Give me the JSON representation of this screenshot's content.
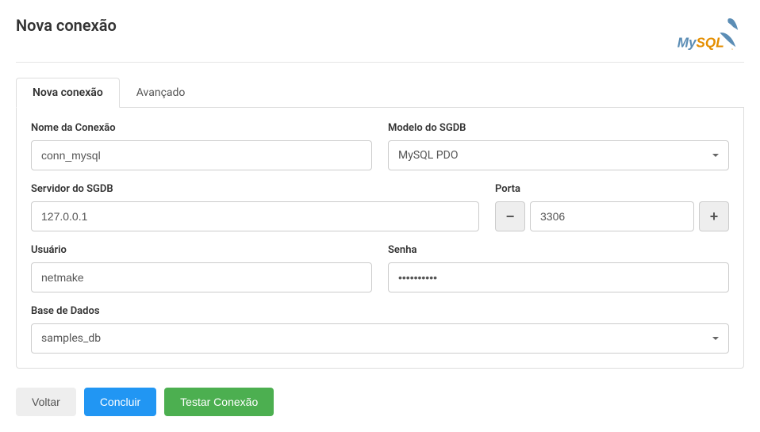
{
  "page_title": "Nova conexão",
  "logo_text": "MySQL",
  "tabs": {
    "new_connection": "Nova conexão",
    "advanced": "Avançado"
  },
  "form": {
    "connection_name": {
      "label": "Nome da Conexão",
      "value": "conn_mysql"
    },
    "sgdb_model": {
      "label": "Modelo do SGDB",
      "value": "MySQL PDO"
    },
    "sgdb_server": {
      "label": "Servidor do SGDB",
      "value": "127.0.0.1"
    },
    "port": {
      "label": "Porta",
      "value": "3306"
    },
    "user": {
      "label": "Usuário",
      "value": "netmake"
    },
    "password": {
      "label": "Senha",
      "value": "••••••••••"
    },
    "database": {
      "label": "Base de Dados",
      "value": "samples_db"
    }
  },
  "buttons": {
    "back": "Voltar",
    "finish": "Concluir",
    "test": "Testar Conexão"
  },
  "stepper": {
    "minus": "−",
    "plus": "+"
  }
}
